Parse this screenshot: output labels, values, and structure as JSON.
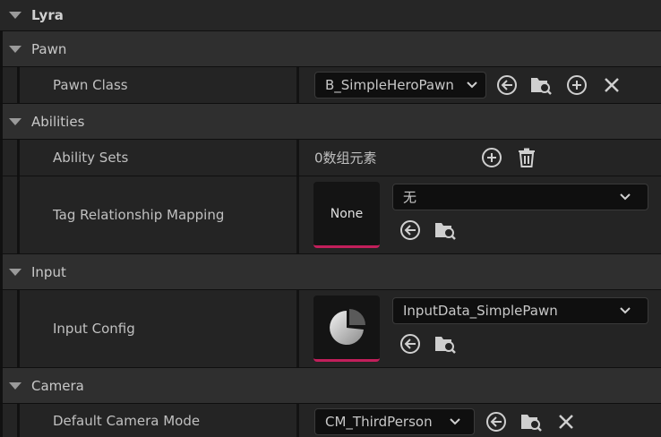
{
  "categories": {
    "lyra": "Lyra",
    "pawn": "Pawn",
    "abilities": "Abilities",
    "input": "Input",
    "camera": "Camera"
  },
  "properties": {
    "pawn_class": {
      "label": "Pawn Class",
      "value": "B_SimpleHeroPawn"
    },
    "ability_sets": {
      "label": "Ability Sets",
      "value": "0数组元素"
    },
    "tag_relationship_mapping": {
      "label": "Tag Relationship Mapping",
      "thumb": "None",
      "value": "无"
    },
    "input_config": {
      "label": "Input Config",
      "value": "InputData_SimplePawn"
    },
    "default_camera_mode": {
      "label": "Default Camera Mode",
      "value": "CM_ThirdPerson"
    }
  },
  "colors": {
    "accent": "#c21f5b",
    "icon": "#cfcfcf"
  }
}
